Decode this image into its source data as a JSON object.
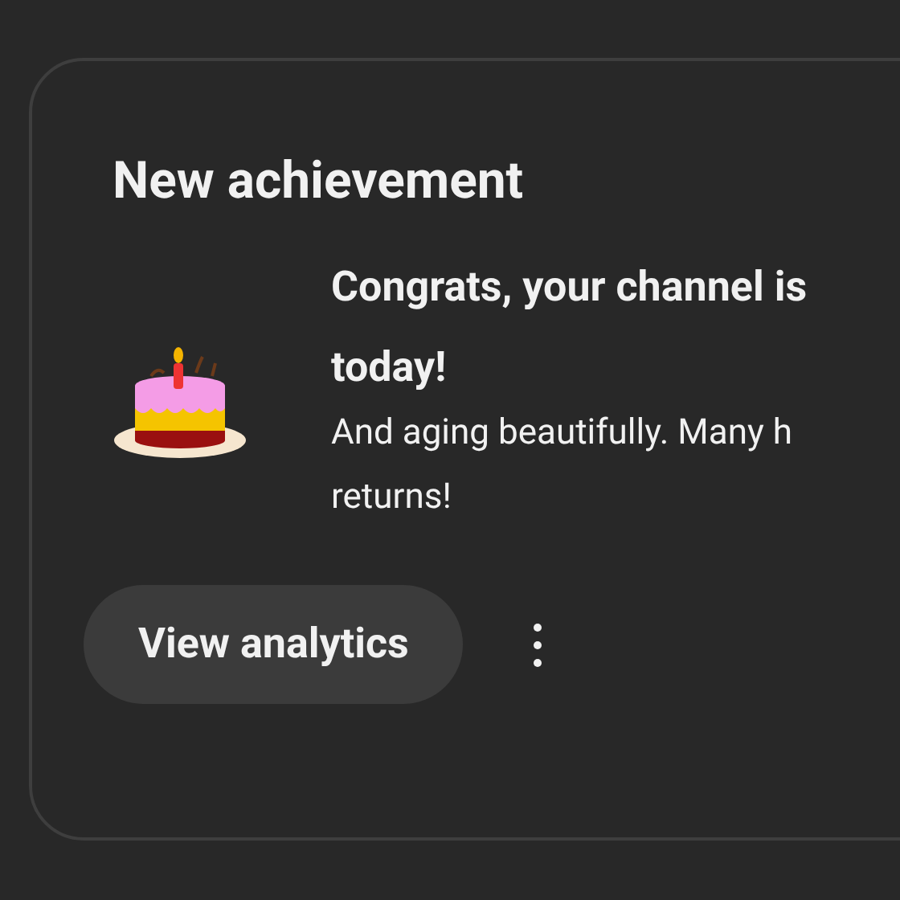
{
  "card": {
    "heading": "New achievement",
    "title_lines": [
      "Congrats, your channel is",
      "today!"
    ],
    "description_lines": [
      "And aging beautifully. Many h",
      "returns!"
    ],
    "button": "View analytics"
  }
}
